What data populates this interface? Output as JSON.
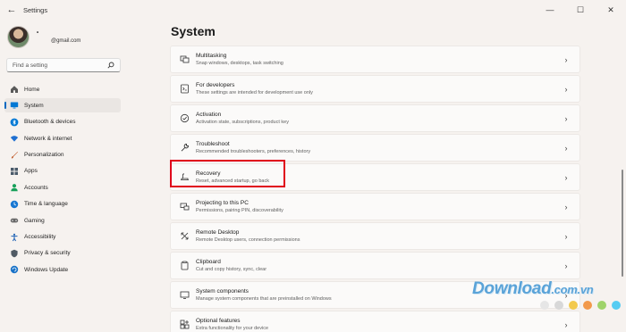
{
  "app": {
    "title": "Settings",
    "back_glyph": "←",
    "window_controls": {
      "minimize": "—",
      "maximize": "☐",
      "close": "✕"
    }
  },
  "profile": {
    "name": "•",
    "email": "@gmail.com"
  },
  "search": {
    "placeholder": "Find a setting",
    "icon": "search-icon"
  },
  "sidebar": {
    "items": [
      {
        "label": "Home",
        "icon": "home-icon",
        "color": "#5a5a5a",
        "selected": false
      },
      {
        "label": "System",
        "icon": "monitor-icon",
        "color": "#0078d4",
        "selected": true
      },
      {
        "label": "Bluetooth & devices",
        "icon": "bluetooth-icon",
        "color": "#0078d4",
        "selected": false
      },
      {
        "label": "Network & internet",
        "icon": "wifi-icon",
        "color": "#1f6fd1",
        "selected": false
      },
      {
        "label": "Personalization",
        "icon": "brush-icon",
        "color": "#c05a2a",
        "selected": false
      },
      {
        "label": "Apps",
        "icon": "apps-icon",
        "color": "#4a5a6a",
        "selected": false
      },
      {
        "label": "Accounts",
        "icon": "person-icon",
        "color": "#18a05a",
        "selected": false
      },
      {
        "label": "Time & language",
        "icon": "globe-clock-icon",
        "color": "#1877d2",
        "selected": false
      },
      {
        "label": "Gaming",
        "icon": "gamepad-icon",
        "color": "#666666",
        "selected": false
      },
      {
        "label": "Accessibility",
        "icon": "accessibility-icon",
        "color": "#1a5fb4",
        "selected": false
      },
      {
        "label": "Privacy & security",
        "icon": "shield-icon",
        "color": "#505a64",
        "selected": false
      },
      {
        "label": "Windows Update",
        "icon": "update-icon",
        "color": "#1a73c8",
        "selected": false
      }
    ]
  },
  "main": {
    "title": "System",
    "cards": [
      {
        "title": "Multitasking",
        "desc": "Snap windows, desktops, task switching",
        "icon": "multitasking-icon"
      },
      {
        "title": "For developers",
        "desc": "These settings are intended for development use only",
        "icon": "developer-tools-icon"
      },
      {
        "title": "Activation",
        "desc": "Activation state, subscriptions, product key",
        "icon": "check-circle-icon"
      },
      {
        "title": "Troubleshoot",
        "desc": "Recommended troubleshooters, preferences, history",
        "icon": "wrench-icon"
      },
      {
        "title": "Recovery",
        "desc": "Reset, advanced startup, go back",
        "icon": "recovery-icon",
        "highlighted": true
      },
      {
        "title": "Projecting to this PC",
        "desc": "Permissions, pairing PIN, discoverability",
        "icon": "projecting-icon"
      },
      {
        "title": "Remote Desktop",
        "desc": "Remote Desktop users, connection permissions",
        "icon": "remote-desktop-icon"
      },
      {
        "title": "Clipboard",
        "desc": "Cut and copy history, sync, clear",
        "icon": "clipboard-icon"
      },
      {
        "title": "System components",
        "desc": "Manage system components that are preinstalled on Windows",
        "icon": "system-components-icon"
      },
      {
        "title": "Optional features",
        "desc": "Extra functionality for your device",
        "icon": "optional-features-icon"
      }
    ],
    "chevron": "›"
  },
  "watermark": {
    "text": "Download",
    "suffix": ".com.vn",
    "dot_colors": [
      "#e6e6e6",
      "#d8d8d8",
      "#f2c94c",
      "#f2994a",
      "#9fd36b",
      "#56ccf2"
    ]
  },
  "colors": {
    "accent": "#0067c0",
    "highlight_border": "#e0001b"
  }
}
